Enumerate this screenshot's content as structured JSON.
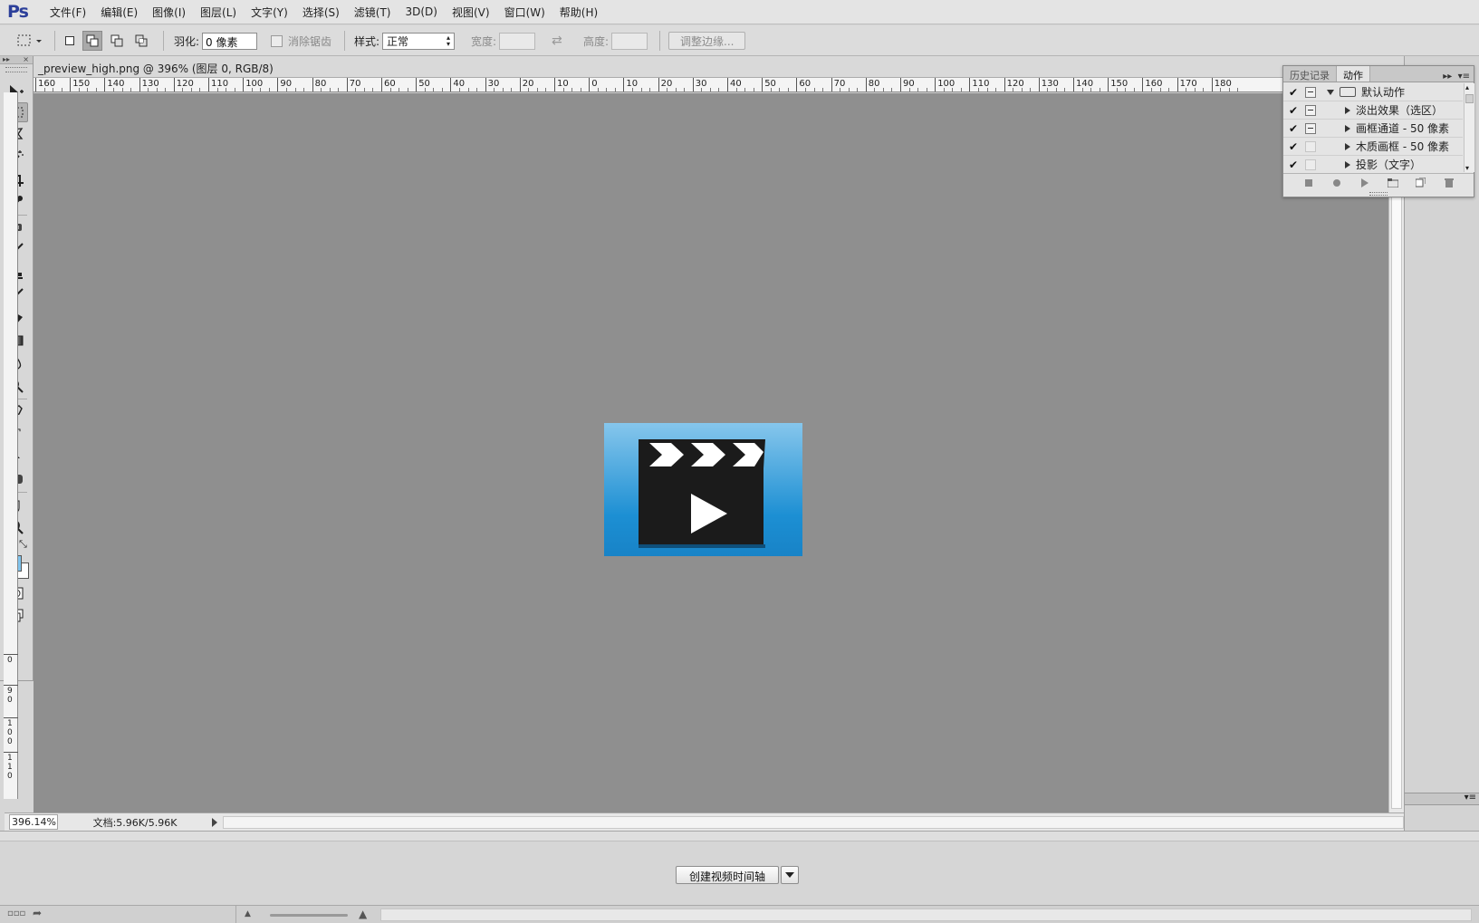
{
  "app": {
    "logo": "Ps"
  },
  "menu": [
    "文件(F)",
    "编辑(E)",
    "图像(I)",
    "图层(L)",
    "文字(Y)",
    "选择(S)",
    "滤镜(T)",
    "3D(D)",
    "视图(V)",
    "窗口(W)",
    "帮助(H)"
  ],
  "options": {
    "feather_label": "羽化:",
    "feather_value": "0 像素",
    "antialias_label": "消除锯齿",
    "style_label": "样式:",
    "style_value": "正常",
    "width_label": "宽度:",
    "height_label": "高度:",
    "refine_edge_label": "调整边缘..."
  },
  "document": {
    "title": "_preview_high.png @ 396% (图层 0, RGB/8)",
    "zoom": "396.14%",
    "doc_info": "文档:5.96K/5.96K",
    "ruler_h_labels": [
      "160",
      "150",
      "140",
      "130",
      "120",
      "110",
      "100",
      "90",
      "80",
      "70",
      "60",
      "50",
      "40",
      "30",
      "20",
      "10",
      "0",
      "10",
      "20",
      "30",
      "40",
      "50",
      "60",
      "70",
      "80",
      "90",
      "100",
      "110",
      "120",
      "130",
      "140",
      "150",
      "160",
      "170",
      "180"
    ],
    "ruler_v_labels": [
      "0",
      "9 0",
      "1 0 0",
      "1 1 0"
    ]
  },
  "actions_panel": {
    "tab_history": "历史记录",
    "tab_actions": "动作",
    "items": [
      {
        "label": "默认动作",
        "checked": true,
        "dialog": true,
        "kind": "set"
      },
      {
        "label": "淡出效果（选区）",
        "checked": true,
        "dialog": true,
        "kind": "action"
      },
      {
        "label": "画框通道 - 50 像素",
        "checked": true,
        "dialog": true,
        "kind": "action"
      },
      {
        "label": "木质画框 - 50 像素",
        "checked": true,
        "dialog": false,
        "kind": "action"
      },
      {
        "label": "投影（文字）",
        "checked": true,
        "dialog": false,
        "kind": "action"
      }
    ]
  },
  "timeline": {
    "create_video_label": "创建视频时间轴"
  },
  "colors": {
    "foreground": "#7fc3ec",
    "background": "#ffffff",
    "canvas": "#8f8f8f",
    "logo": "#2c3f9a"
  }
}
